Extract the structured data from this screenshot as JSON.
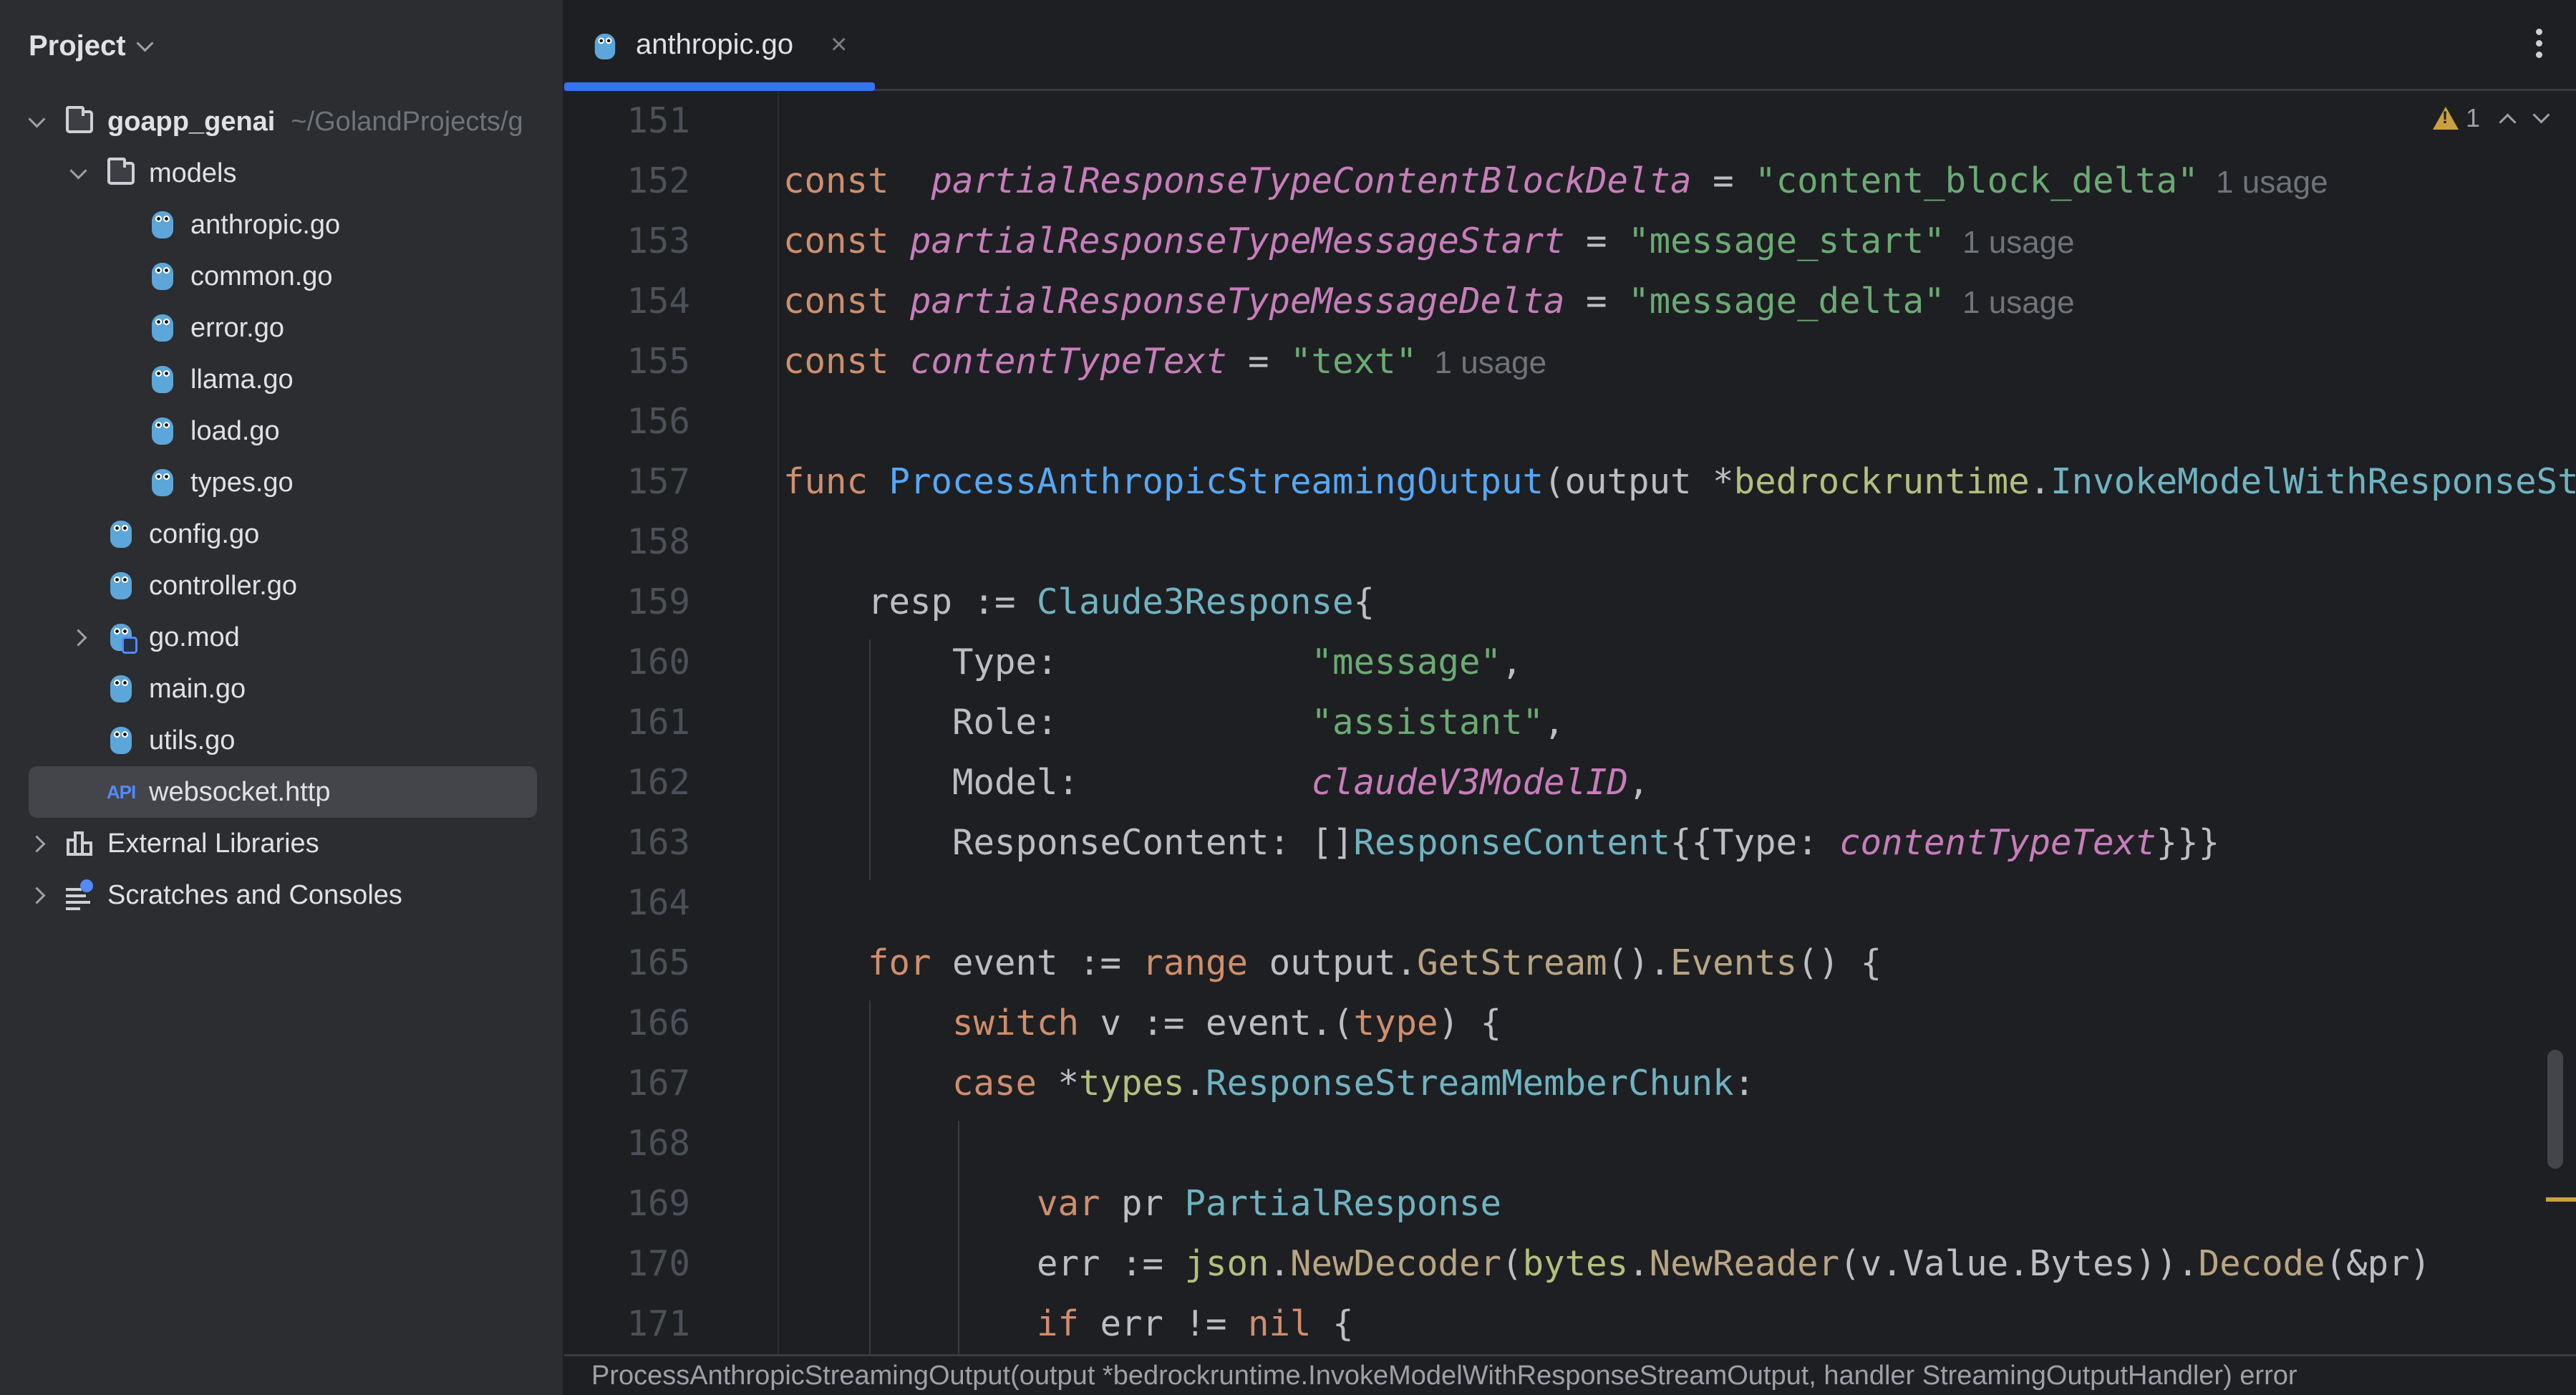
{
  "sidebar": {
    "title": "Project",
    "tree": [
      {
        "label": "goapp_genai",
        "hint": "~/GolandProjects/g",
        "type": "folder",
        "expanded": true,
        "depth": 0
      },
      {
        "label": "models",
        "type": "folder",
        "expanded": true,
        "depth": 1
      },
      {
        "label": "anthropic.go",
        "type": "go",
        "depth": 2
      },
      {
        "label": "common.go",
        "type": "go",
        "depth": 2
      },
      {
        "label": "error.go",
        "type": "go",
        "depth": 2
      },
      {
        "label": "llama.go",
        "type": "go",
        "depth": 2
      },
      {
        "label": "load.go",
        "type": "go",
        "depth": 2
      },
      {
        "label": "types.go",
        "type": "go",
        "depth": 2
      },
      {
        "label": "config.go",
        "type": "go",
        "depth": 1
      },
      {
        "label": "controller.go",
        "type": "go",
        "depth": 1
      },
      {
        "label": "go.mod",
        "type": "gomod",
        "collapsed": true,
        "depth": 1
      },
      {
        "label": "main.go",
        "type": "go",
        "depth": 1
      },
      {
        "label": "utils.go",
        "type": "go",
        "depth": 1
      },
      {
        "label": "websocket.http",
        "type": "http",
        "depth": 1,
        "selected": true
      },
      {
        "label": "External Libraries",
        "type": "libraries",
        "collapsed": true,
        "depth": 0
      },
      {
        "label": "Scratches and Consoles",
        "type": "scratches",
        "collapsed": true,
        "depth": 0
      }
    ],
    "api_icon_text": "API"
  },
  "editor": {
    "tab": {
      "label": "anthropic.go",
      "close": "×"
    },
    "inspections": {
      "warnings": "1"
    },
    "lines": [
      {
        "n": "151",
        "tokens": []
      },
      {
        "n": "152",
        "tokens": [
          [
            "k",
            "const"
          ],
          [
            "",
            "  "
          ],
          [
            "c",
            "partialResponseTypeContentBlockDelta"
          ],
          [
            "",
            " = "
          ],
          [
            "s",
            "\"content_block_delta\""
          ],
          [
            "",
            ""
          ],
          [
            "u",
            "1 usage"
          ]
        ]
      },
      {
        "n": "153",
        "tokens": [
          [
            "k",
            "const"
          ],
          [
            "",
            " "
          ],
          [
            "c",
            "partialResponseTypeMessageStart"
          ],
          [
            "",
            " = "
          ],
          [
            "s",
            "\"message_start\""
          ],
          [
            "u",
            "1 usage"
          ]
        ]
      },
      {
        "n": "154",
        "tokens": [
          [
            "k",
            "const"
          ],
          [
            "",
            " "
          ],
          [
            "c",
            "partialResponseTypeMessageDelta"
          ],
          [
            "",
            " = "
          ],
          [
            "s",
            "\"message_delta\""
          ],
          [
            "u",
            "1 usage"
          ]
        ]
      },
      {
        "n": "155",
        "tokens": [
          [
            "k",
            "const"
          ],
          [
            "",
            " "
          ],
          [
            "c",
            "contentTypeText"
          ],
          [
            "",
            " = "
          ],
          [
            "s",
            "\"text\""
          ],
          [
            "u",
            "1 usage"
          ]
        ]
      },
      {
        "n": "156",
        "tokens": []
      },
      {
        "n": "157",
        "tokens": [
          [
            "k",
            "func"
          ],
          [
            "",
            " "
          ],
          [
            "f",
            "ProcessAnthropicStreamingOutput"
          ],
          [
            "",
            "(output *"
          ],
          [
            "p",
            "bedrockruntime"
          ],
          [
            "",
            "."
          ],
          [
            "t",
            "InvokeModelWithResponseStreamOutput"
          ],
          [
            "",
            ", handler StreamingOutputHandler) error {"
          ]
        ]
      },
      {
        "n": "158",
        "tokens": []
      },
      {
        "n": "159",
        "tokens": [
          [
            "",
            "    resp := "
          ],
          [
            "t",
            "Claude3Response"
          ],
          [
            "",
            "{"
          ]
        ]
      },
      {
        "n": "160",
        "tokens": [
          [
            "",
            "        Type:            "
          ],
          [
            "s",
            "\"message\""
          ],
          [
            "",
            ","
          ]
        ]
      },
      {
        "n": "161",
        "tokens": [
          [
            "",
            "        Role:            "
          ],
          [
            "s",
            "\"assistant\""
          ],
          [
            "",
            ","
          ]
        ]
      },
      {
        "n": "162",
        "tokens": [
          [
            "",
            "        Model:           "
          ],
          [
            "c",
            "claudeV3ModelID"
          ],
          [
            "",
            ","
          ]
        ]
      },
      {
        "n": "163",
        "tokens": [
          [
            "",
            "        ResponseContent: []"
          ],
          [
            "t",
            "ResponseContent"
          ],
          [
            "",
            "{{Type: "
          ],
          [
            "c",
            "contentTypeText"
          ],
          [
            "",
            "}}}"
          ]
        ]
      },
      {
        "n": "164",
        "tokens": []
      },
      {
        "n": "165",
        "tokens": [
          [
            "",
            "    "
          ],
          [
            "k",
            "for"
          ],
          [
            "",
            " event := "
          ],
          [
            "k",
            "range"
          ],
          [
            "",
            " output."
          ],
          [
            "m",
            "GetStream"
          ],
          [
            "",
            "()."
          ],
          [
            "m",
            "Events"
          ],
          [
            "",
            "() {"
          ]
        ]
      },
      {
        "n": "166",
        "tokens": [
          [
            "",
            "        "
          ],
          [
            "k",
            "switch"
          ],
          [
            "",
            " v := event.("
          ],
          [
            "k",
            "type"
          ],
          [
            "",
            ") {"
          ]
        ]
      },
      {
        "n": "167",
        "tokens": [
          [
            "",
            "        "
          ],
          [
            "k",
            "case"
          ],
          [
            "",
            " *"
          ],
          [
            "p",
            "types"
          ],
          [
            "",
            "."
          ],
          [
            "t",
            "ResponseStreamMemberChunk"
          ],
          [
            "",
            ":"
          ]
        ]
      },
      {
        "n": "168",
        "tokens": []
      },
      {
        "n": "169",
        "tokens": [
          [
            "",
            "            "
          ],
          [
            "k",
            "var"
          ],
          [
            "",
            " pr "
          ],
          [
            "t",
            "PartialResponse"
          ]
        ]
      },
      {
        "n": "170",
        "tokens": [
          [
            "",
            "            err := "
          ],
          [
            "p",
            "json"
          ],
          [
            "",
            "."
          ],
          [
            "m",
            "NewDecoder"
          ],
          [
            "",
            "("
          ],
          [
            "p",
            "bytes"
          ],
          [
            "",
            "."
          ],
          [
            "m",
            "NewReader"
          ],
          [
            "",
            "(v.Value.Bytes))."
          ],
          [
            "m",
            "Decode"
          ],
          [
            "",
            "(&pr)"
          ]
        ]
      },
      {
        "n": "171",
        "tokens": [
          [
            "",
            "            "
          ],
          [
            "k",
            "if"
          ],
          [
            "",
            " err != "
          ],
          [
            "k",
            "nil"
          ],
          [
            "",
            " {"
          ]
        ]
      }
    ]
  },
  "statusbar": {
    "signature": "ProcessAnthropicStreamingOutput(output *bedrockruntime.InvokeModelWithResponseStreamOutput, handler StreamingOutputHandler) error"
  },
  "colors": {
    "accent": "#3574f0",
    "keyword": "#cf8e6d",
    "constant": "#c77dbb",
    "string": "#6aab73",
    "function": "#56a8f5",
    "type": "#6fb3c2",
    "package": "#b3bf7e",
    "method": "#b8a582",
    "warning": "#c9a042"
  }
}
